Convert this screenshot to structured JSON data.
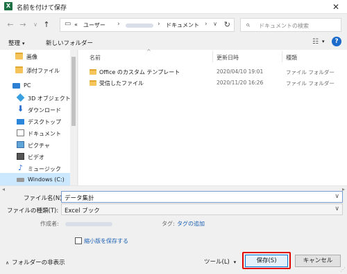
{
  "window": {
    "title": "名前を付けて保存",
    "app_icon_letter": "X",
    "close_glyph": "✕"
  },
  "nav": {
    "back_glyph": "←",
    "forward_glyph": "→",
    "recent_glyph": "∨",
    "up_glyph": "↑",
    "breadcrumb": [
      "«",
      "ユーザー",
      "ドキュメント"
    ],
    "separator": "›",
    "search_placeholder": "ドキュメントの検索"
  },
  "commands": {
    "organize": "整理",
    "new_folder": "新しいフォルダー",
    "view_glyph": "☷",
    "help_glyph": "?"
  },
  "sidebar": {
    "items": [
      {
        "label": "画像",
        "icon": "folder-icon"
      },
      {
        "label": "添付ファイル",
        "icon": "folder-icon"
      },
      {
        "label": "PC",
        "icon": "pc-icon"
      },
      {
        "label": "3D オブジェクト",
        "icon": "3d-objects-icon"
      },
      {
        "label": "ダウンロード",
        "icon": "download-icon"
      },
      {
        "label": "デスクトップ",
        "icon": "desktop-icon"
      },
      {
        "label": "ドキュメント",
        "icon": "documents-icon"
      },
      {
        "label": "ピクチャ",
        "icon": "pictures-icon"
      },
      {
        "label": "ビデオ",
        "icon": "videos-icon"
      },
      {
        "label": "ミュージック",
        "icon": "music-icon"
      },
      {
        "label": "Windows (C:)",
        "icon": "drive-icon"
      }
    ]
  },
  "filelist": {
    "columns": {
      "name": "名前",
      "date": "更新日時",
      "type": "種類"
    },
    "rows": [
      {
        "name": "Office のカスタム テンプレート",
        "date": "2020/04/10 19:01",
        "type": "ファイル フォルダー"
      },
      {
        "name": "受信したファイル",
        "date": "2020/11/20 16:26",
        "type": "ファイル フォルダー"
      }
    ]
  },
  "form": {
    "filename_label": "ファイル名(N):",
    "filename_value": "データ集計",
    "filetype_label": "ファイルの種類(T):",
    "filetype_value": "Excel ブック",
    "author_label": "作成者:",
    "tags_label": "タグ:",
    "tags_link": "タグの追加",
    "thumbnail_label": "縮小版を保存する"
  },
  "footer": {
    "hide_folders": "フォルダーの非表示",
    "tools": "ツール(L)",
    "save": "保存(S)",
    "cancel": "キャンセル"
  },
  "colors": {
    "highlight": "#e00000",
    "selection": "#cce8ff",
    "accent": "#0078d7"
  }
}
